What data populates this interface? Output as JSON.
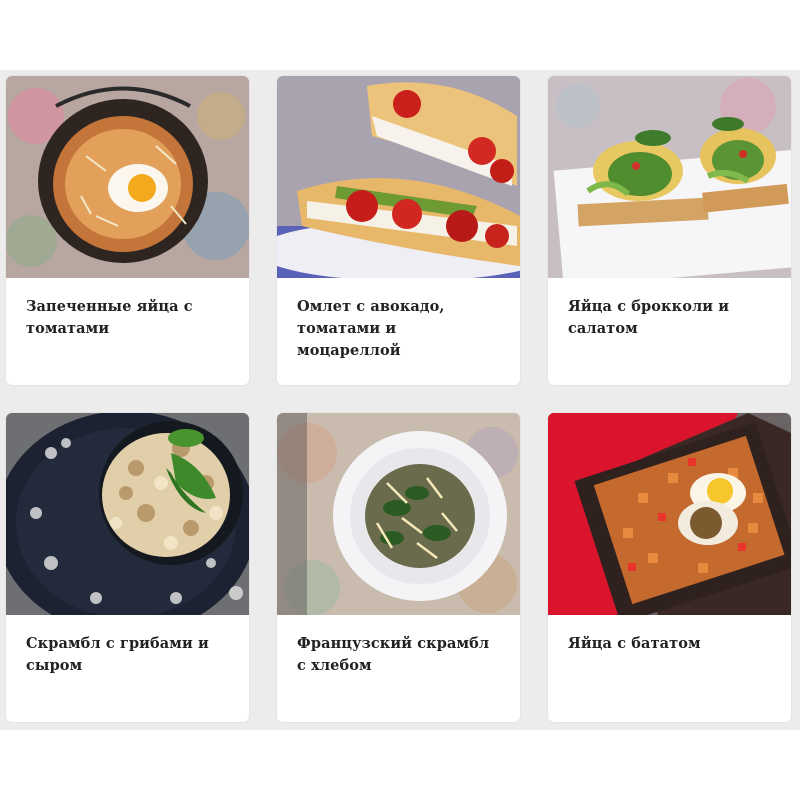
{
  "recipes": [
    {
      "title": "Запеченные яйца с томатами",
      "image": "baked-eggs-tomatoes-in-pot"
    },
    {
      "title": "Омлет с авокадо, томатами и моцареллой",
      "image": "omelette-wrap-avocado-tomato"
    },
    {
      "title": "Яйца с брокколи и салатом",
      "image": "egg-rolls-broccoli-salad"
    },
    {
      "title": "Скрамбл с грибами и сыром",
      "image": "scramble-mushrooms-cheese"
    },
    {
      "title": "Французский скрамбл с хлебом",
      "image": "french-scramble-bread-bowl"
    },
    {
      "title": "Яйца с бататом",
      "image": "eggs-sweet-potato-tray"
    }
  ],
  "colors": {
    "grid_background": "#ececec",
    "card_background": "#ffffff",
    "title_text": "#222222"
  }
}
